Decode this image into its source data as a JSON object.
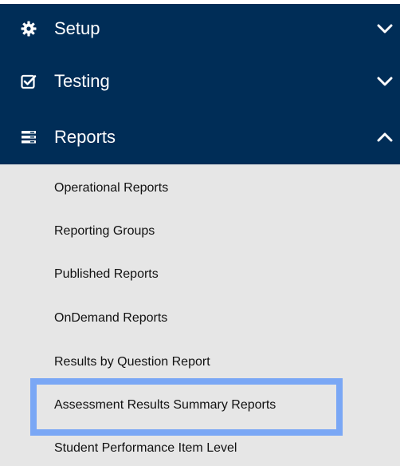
{
  "nav": {
    "setup": {
      "label": "Setup",
      "icon": "gear-icon",
      "chevron": "chevron-down-icon"
    },
    "testing": {
      "label": "Testing",
      "icon": "checkbox-icon",
      "chevron": "chevron-down-icon"
    },
    "reports": {
      "label": "Reports",
      "icon": "reports-icon",
      "chevron": "chevron-up-icon"
    }
  },
  "reports_items": [
    "Operational Reports",
    "Reporting Groups",
    "Published Reports",
    "OnDemand Reports",
    "Results by Question Report",
    "Assessment Results Summary Reports",
    "Student Performance Item Level"
  ],
  "colors": {
    "nav_background": "#002d57",
    "submenu_background": "#e6e6e6",
    "highlight": "#7aa7f5"
  }
}
